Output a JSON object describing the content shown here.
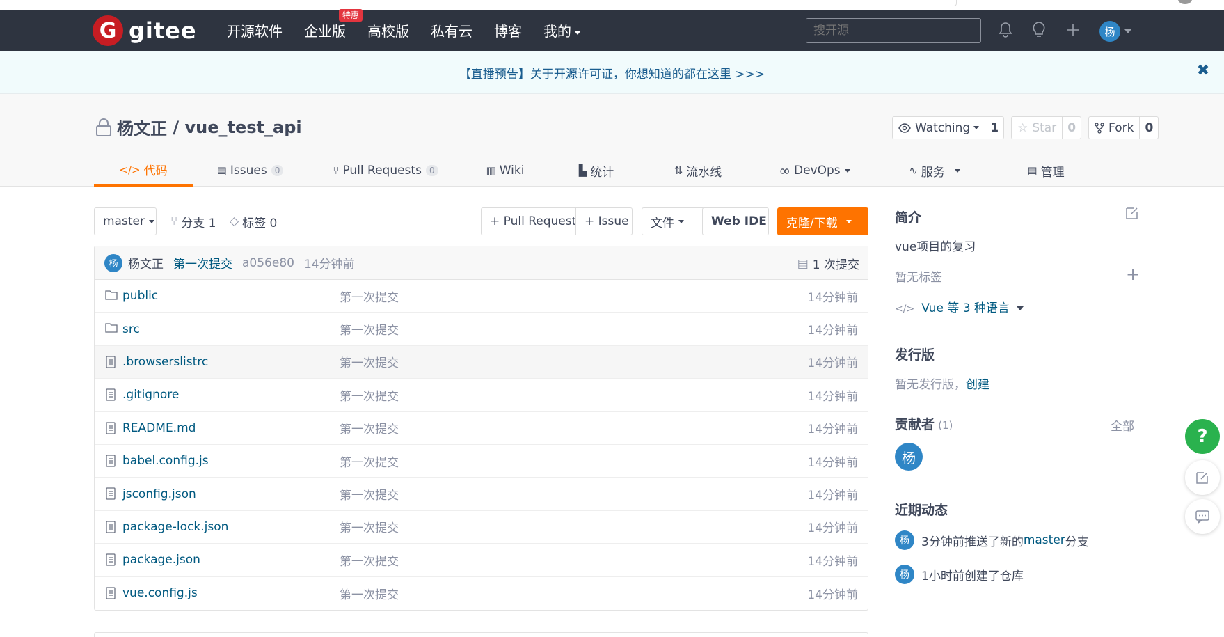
{
  "header": {
    "logo_mark": "G",
    "logo_text": "gitee",
    "nav": [
      {
        "label": "开源软件"
      },
      {
        "label": "企业版",
        "badge": "特惠"
      },
      {
        "label": "高校版"
      },
      {
        "label": "私有云"
      },
      {
        "label": "博客"
      },
      {
        "label": "我的"
      }
    ],
    "search_placeholder": "搜开源",
    "user_avatar": "杨"
  },
  "banner": {
    "text": "【直播预告】关于开源许可证，你想知道的都在这里 >>>",
    "close": "✖"
  },
  "repo": {
    "owner": "杨文正",
    "separator": " / ",
    "name": "vue_test_api",
    "watching_label": "Watching",
    "watching_count": "1",
    "star_label": "Star",
    "star_count": "0",
    "fork_label": "Fork",
    "fork_count": "0"
  },
  "tabs": [
    {
      "label": "代码",
      "icon": "</>"
    },
    {
      "label": "Issues",
      "count": "0"
    },
    {
      "label": "Pull Requests",
      "count": "0"
    },
    {
      "label": "Wiki"
    },
    {
      "label": "统计"
    },
    {
      "label": "流水线"
    },
    {
      "label": "DevOps"
    },
    {
      "label": "服务"
    },
    {
      "label": "管理"
    }
  ],
  "toolbar": {
    "branch": "master",
    "branches": "分支 1",
    "tags": "标签 0",
    "pull_request": "+ Pull Request",
    "issue": "+ Issue",
    "file": "文件",
    "web_ide": "Web IDE",
    "clone": "克隆/下载"
  },
  "commit": {
    "avatar": "杨",
    "author": "杨文正",
    "message": "第一次提交",
    "hash": "a056e80",
    "time": "14分钟前",
    "count": "1 次提交"
  },
  "files": [
    {
      "name": "public",
      "type": "folder",
      "message": "第一次提交",
      "time": "14分钟前"
    },
    {
      "name": "src",
      "type": "folder",
      "message": "第一次提交",
      "time": "14分钟前"
    },
    {
      "name": ".browserslistrc",
      "type": "file",
      "message": "第一次提交",
      "time": "14分钟前"
    },
    {
      "name": ".gitignore",
      "type": "file",
      "message": "第一次提交",
      "time": "14分钟前"
    },
    {
      "name": "README.md",
      "type": "file",
      "message": "第一次提交",
      "time": "14分钟前"
    },
    {
      "name": "babel.config.js",
      "type": "file",
      "message": "第一次提交",
      "time": "14分钟前"
    },
    {
      "name": "jsconfig.json",
      "type": "file",
      "message": "第一次提交",
      "time": "14分钟前"
    },
    {
      "name": "package-lock.json",
      "type": "file",
      "message": "第一次提交",
      "time": "14分钟前"
    },
    {
      "name": "package.json",
      "type": "file",
      "message": "第一次提交",
      "time": "14分钟前"
    },
    {
      "name": "vue.config.js",
      "type": "file",
      "message": "第一次提交",
      "time": "14分钟前"
    }
  ],
  "sidebar": {
    "intro_title": "简介",
    "description": "vue项目的复习",
    "no_tags": "暂无标签",
    "languages": "Vue 等 3 种语言",
    "releases_title": "发行版",
    "no_releases": "暂无发行版，",
    "create_release": "创建",
    "contributors_title": "贡献者",
    "contributors_count": "(1)",
    "contributors_all": "全部",
    "contributor_avatar": "杨",
    "activity_title": "近期动态",
    "activities": [
      {
        "avatar": "杨",
        "prefix": "3分钟前推送了新的 ",
        "branch": "master",
        "suffix": " 分支"
      },
      {
        "avatar": "杨",
        "prefix": "1小时前创建了仓库",
        "branch": "",
        "suffix": ""
      }
    ]
  },
  "float": {
    "help": "?"
  },
  "colors": {
    "header_bg": "#2e3440",
    "accent": "#fe7300",
    "link": "#005980",
    "avatar": "#2f86c6",
    "help": "#2ab24e",
    "logo": "#c71d23"
  }
}
